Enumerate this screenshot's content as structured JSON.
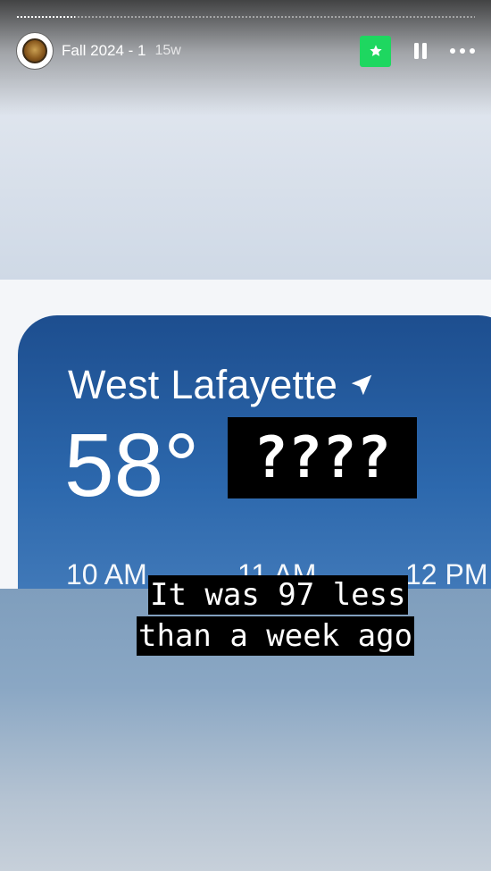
{
  "story": {
    "title": "Fall 2024 - 1",
    "age": "15w",
    "avatar_icon": "avatar-icon",
    "controls": {
      "favorite_icon": "star-icon",
      "pause_icon": "pause-icon",
      "more_icon": "more-icon",
      "accent": "#1ed760"
    }
  },
  "photo": {
    "city": "West Lafayette",
    "temperature": "58°",
    "hours": [
      "10 AM",
      "11 AM",
      "12 PM"
    ]
  },
  "stickers": {
    "question": "????",
    "caption_line1": "It was 97 less",
    "caption_line2": "than a week ago"
  }
}
